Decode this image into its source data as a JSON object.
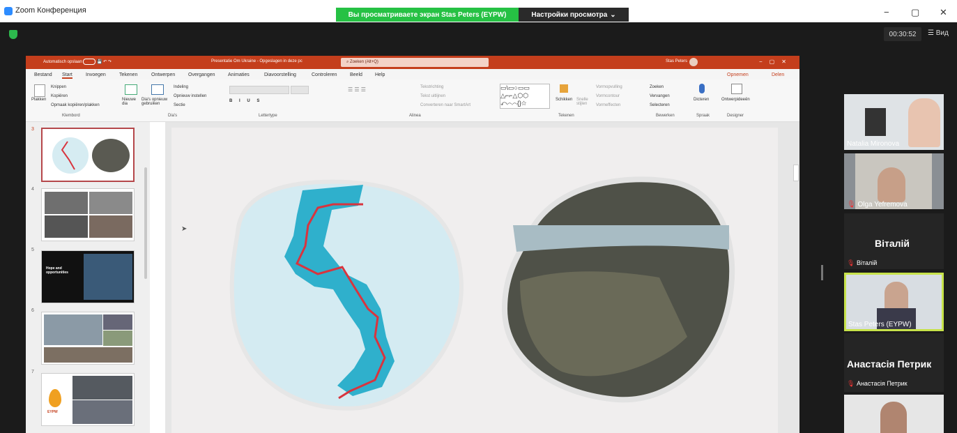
{
  "zoom": {
    "window_title": "Zoom Конференция",
    "share_banner": "Вы просматриваете экран Stas Peters (EYPW)",
    "view_settings": "Настройки просмотра",
    "timer": "00:30:52",
    "view_label": "Вид",
    "minimize": "−",
    "maximize": "▢",
    "close": "✕"
  },
  "ppt": {
    "autosave": "Automatisch opslaan",
    "doc_name": "Presentatie Om Ukraine - Opgeslagen in deze pc",
    "search": "Zoeken (Alt+Q)",
    "user": "Stas Peters",
    "tabs": [
      "Bestand",
      "Start",
      "Invoegen",
      "Tekenen",
      "Ontwerpen",
      "Overgangen",
      "Animaties",
      "Diavoorstelling",
      "Controleren",
      "Beeld",
      "Help"
    ],
    "share_buttons": [
      "Opnemen",
      "Delen"
    ],
    "ribbon_groups": [
      "Klembord",
      "Dia's",
      "Lettertype",
      "Alinea",
      "Tekenen",
      "Bewerken",
      "Spraak",
      "Designer"
    ],
    "ribbon_items": {
      "paste": "Plakken",
      "cut": "Knippen",
      "copy": "Kopiëren",
      "format_painter": "Opmaak kopiëren/plakken",
      "new_slide": "Nieuwe dia",
      "reuse_slides": "Dia's opnieuw gebruiken",
      "layout": "Indeling",
      "reset": "Opnieuw instellen",
      "section": "Sectie",
      "text_direction": "Tekstrichting",
      "align_text": "Tekst uitlijnen",
      "smartart": "Converteren naar SmartArt",
      "arrange": "Schikken",
      "quick_styles": "Snelle stijlen",
      "fill": "Vormopvulling",
      "outline": "Vormcontour",
      "effects": "Vormeffecten",
      "find": "Zoeken",
      "replace": "Vervangen",
      "select": "Selecteren",
      "dictate": "Dicteren",
      "design_ideas": "Ontwerpideeën"
    },
    "thumb_numbers": [
      "3",
      "4",
      "5",
      "6",
      "7"
    ],
    "thumb5_text": "Hope and opportunities",
    "thumb7_logo": "EYPW"
  },
  "participants": [
    {
      "name": "Natalia Mironova"
    },
    {
      "name": "Olga Yefremova"
    },
    {
      "big": "Віталій",
      "name": "Віталій"
    },
    {
      "name": "Stas Peters (EYPW)"
    },
    {
      "big": "Анастасія Петрик",
      "name": "Анастасія Петрик"
    }
  ],
  "colors": {
    "ppt_accent": "#c43e1c",
    "banner_green": "#26c144",
    "map_blue": "#2fb0cc",
    "border_red": "#d8343e",
    "active_speaker": "#c7e24a"
  }
}
